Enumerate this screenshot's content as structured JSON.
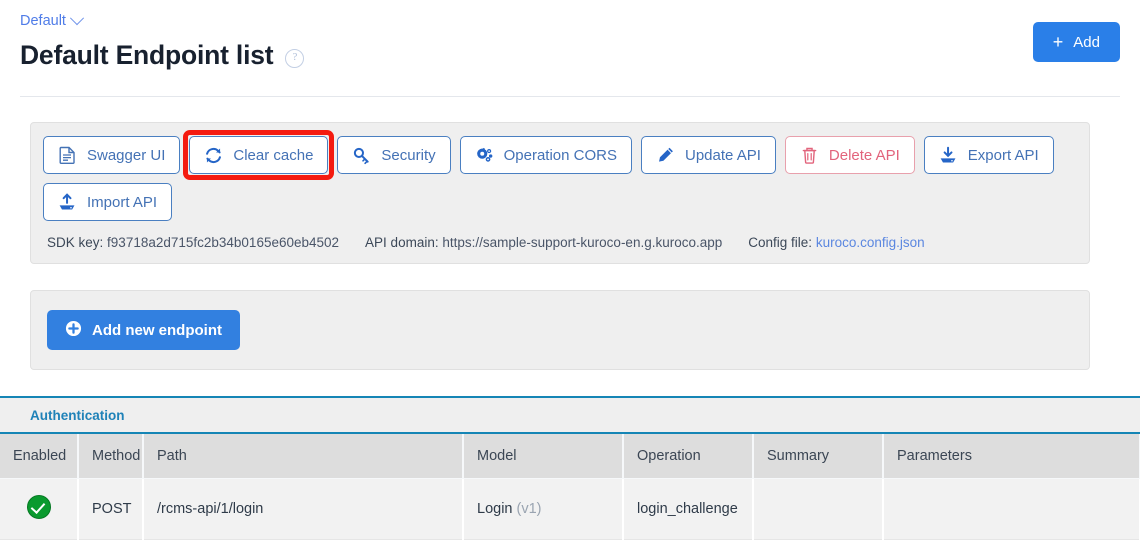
{
  "header": {
    "breadcrumb_label": "Default",
    "breadcrumb_icon": "chevron-down-icon",
    "title": "Default Endpoint list",
    "help_icon": "question-mark-circle-icon",
    "add_button_label": "Add",
    "add_button_icon": "plus-icon",
    "accent_color": "#2a7fe8"
  },
  "toolbar": {
    "buttons": [
      {
        "label": "Swagger UI",
        "icon": "document-icon",
        "style": "default"
      },
      {
        "label": "Clear cache",
        "icon": "refresh-icon",
        "style": "default",
        "highlighted": true
      },
      {
        "label": "Security",
        "icon": "key-icon",
        "style": "default"
      },
      {
        "label": "Operation CORS",
        "icon": "gears-icon",
        "style": "default"
      },
      {
        "label": "Update API",
        "icon": "pencil-icon",
        "style": "default"
      },
      {
        "label": "Delete API",
        "icon": "trash-icon",
        "style": "danger"
      },
      {
        "label": "Export API",
        "icon": "download-icon",
        "style": "default"
      },
      {
        "label": "Import API",
        "icon": "upload-icon",
        "style": "default"
      }
    ],
    "meta": {
      "sdk_key_label": "SDK key:",
      "sdk_key_value": "f93718a2d715fc2b34b0165e60eb4502",
      "api_domain_label": "API domain:",
      "api_domain_value": "https://sample-support-kuroco-en.g.kuroco.app",
      "config_file_label": "Config file:",
      "config_file_value": "kuroco.config.json"
    },
    "highlight_color": "#f41b10"
  },
  "endpoint_panel": {
    "add_endpoint_label": "Add new endpoint",
    "add_endpoint_icon": "plus-circle-icon"
  },
  "tabs": [
    {
      "label": "Authentication",
      "active": true
    }
  ],
  "table": {
    "columns": [
      "Enabled",
      "Method",
      "Path",
      "Model",
      "Operation",
      "Summary",
      "Parameters"
    ],
    "rows": [
      {
        "enabled": true,
        "enabled_icon": "check-circle-icon",
        "method": "POST",
        "path": "/rcms-api/1/login",
        "model": "Login",
        "model_version": "(v1)",
        "operation": "login_challenge",
        "summary": "",
        "parameters": ""
      }
    ]
  }
}
